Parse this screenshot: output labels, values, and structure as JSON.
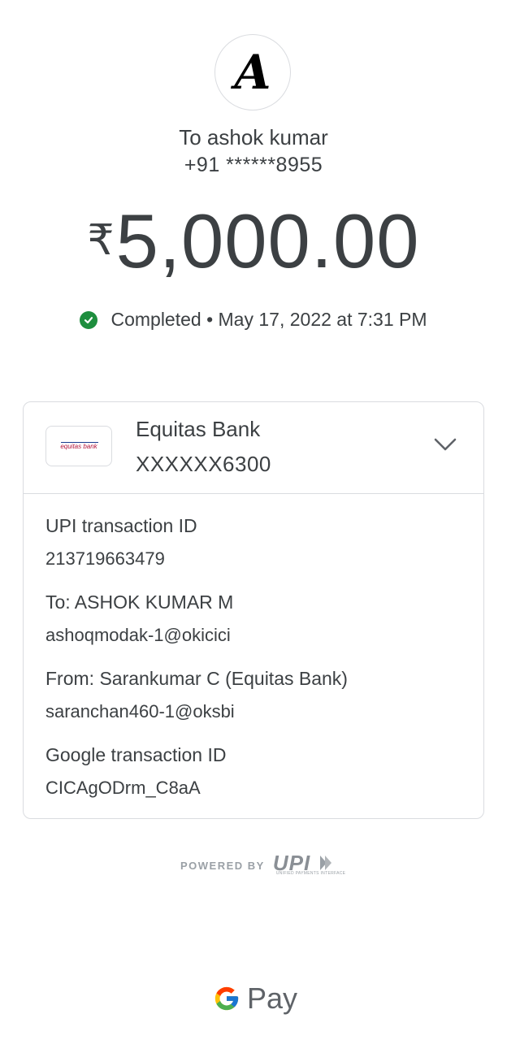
{
  "recipient": {
    "avatar_letter": "A",
    "name": "To ashok kumar",
    "phone": "+91 ******8955"
  },
  "payment": {
    "currency_symbol": "₹",
    "amount": "5,000.00",
    "status": "Completed • May 17, 2022 at 7:31 PM",
    "status_icon": "check-circle-icon",
    "status_color": "#1e8e3e"
  },
  "bank": {
    "logo_text": "equitas bank",
    "name": "Equitas Bank",
    "account": "XXXXXX6300",
    "expand_icon": "chevron-down-icon"
  },
  "details": {
    "upi_label": "UPI transaction ID",
    "upi_value": "213719663479",
    "to_label": "To: ASHOK KUMAR M",
    "to_value": "ashoqmodak-1@okicici",
    "from_label": "From: Sarankumar C (Equitas Bank)",
    "from_value": "saranchan460-1@oksbi",
    "google_label": "Google transaction ID",
    "google_value": "CICAgODrm_C8aA"
  },
  "footer": {
    "powered_by": "POWERED BY",
    "upi_logo": "UPI",
    "upi_sub": "UNIFIED PAYMENTS INTERFACE",
    "gpay_label": "Pay"
  }
}
